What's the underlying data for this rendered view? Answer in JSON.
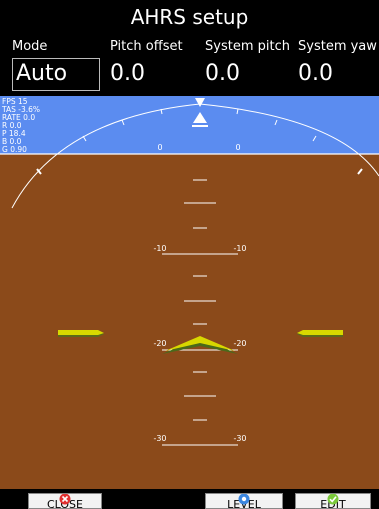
{
  "title": "AHRS setup",
  "fields": [
    {
      "label": "Mode",
      "value": "Auto"
    },
    {
      "label": "Pitch offset",
      "value": "0.0"
    },
    {
      "label": "System pitch",
      "value": "0.0"
    },
    {
      "label": "System yaw",
      "value": "0.0"
    }
  ],
  "telemetry": [
    "FPS 15",
    "TAS -3.6%",
    "RATE 0.0",
    "R 0.0",
    "P 18.4",
    "B 0.0",
    "G 0.90"
  ],
  "horizon": {
    "horizon_marks": [
      "0",
      "0"
    ],
    "pitch_marks": [
      {
        "left": "-10",
        "right": "-10"
      },
      {
        "left": "-20",
        "right": "-20"
      },
      {
        "left": "-30",
        "right": "-30"
      }
    ],
    "colors": {
      "sky": "#5b8cf0",
      "ground": "#8b4a1a",
      "wings": "#d8d800",
      "aircraft_shadow": "#4a6a1a"
    }
  },
  "buttons": [
    {
      "label": "CLOSE",
      "icon": "close-icon"
    },
    {
      "label": "LEVEL",
      "icon": "level-icon"
    },
    {
      "label": "EDIT",
      "icon": "check-icon"
    }
  ]
}
